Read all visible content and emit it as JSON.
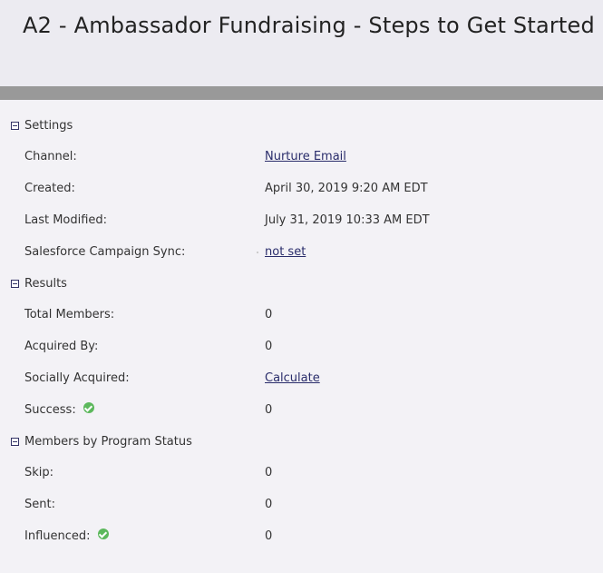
{
  "title": "A2 - Ambassador Fundraising - Steps to Get Started",
  "sections": [
    {
      "label": "Settings",
      "rows": [
        {
          "label": "Channel:",
          "value": "Nurture Email",
          "link": true
        },
        {
          "label": "Created:",
          "value": "April 30, 2019 9:20 AM EDT"
        },
        {
          "label": "Last Modified:",
          "value": "July 31, 2019 10:33 AM EDT"
        },
        {
          "label": "Salesforce Campaign Sync:",
          "value": "not set",
          "link": true
        }
      ]
    },
    {
      "label": "Results",
      "rows": [
        {
          "label": "Total Members:",
          "value": "0"
        },
        {
          "label": "Acquired By:",
          "value": "0"
        },
        {
          "label": "Socially Acquired:",
          "value": "Calculate",
          "link": true
        },
        {
          "label": "Success:",
          "value": "0",
          "icon": "check-circle-icon"
        }
      ]
    },
    {
      "label": "Members by Program Status",
      "rows": [
        {
          "label": "Skip:",
          "value": "0"
        },
        {
          "label": "Sent:",
          "value": "0"
        },
        {
          "label": "Influenced:",
          "value": "0",
          "icon": "check-circle-icon"
        }
      ]
    }
  ],
  "colors": {
    "link": "#2a2d6b",
    "check": "#5cb85c",
    "divider": "#999999"
  }
}
